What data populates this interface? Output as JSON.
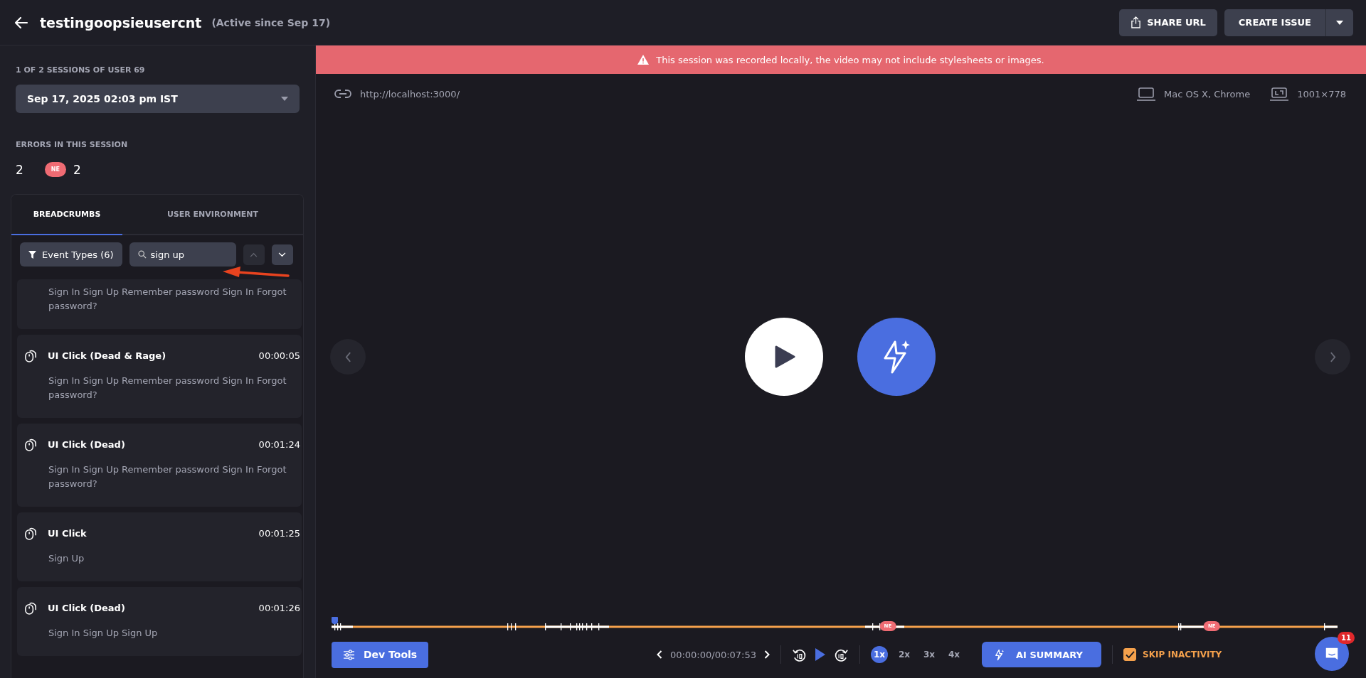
{
  "header": {
    "title": "testingoopsieusercnt",
    "subtitle": "(Active since Sep 17)",
    "share_button": "SHARE URL",
    "create_button": "CREATE ISSUE"
  },
  "sidebar": {
    "sessions_label": "1 OF 2 SESSIONS OF USER 69",
    "session_select": "Sep 17, 2025 02:03 pm IST",
    "errors_label": "ERRORS IN THIS SESSION",
    "error_total": "2",
    "error_badge": "NE",
    "error_badge_count": "2"
  },
  "tabs": [
    {
      "label": "BREADCRUMBS",
      "selected": true
    },
    {
      "label": "USER ENVIRONMENT",
      "selected": false
    }
  ],
  "filter": {
    "event_types": "Event Types (6)",
    "search_value": "sign up",
    "prev_disabled": true,
    "next_disabled": false
  },
  "events": [
    {
      "kind": "clipped",
      "detail": "Sign In Sign Up Remember password Sign In Forgot password?"
    },
    {
      "kind": "full",
      "title": "UI Click (Dead & Rage)",
      "time": "00:00:05",
      "detail": "Sign In Sign Up Remember password Sign In Forgot password?"
    },
    {
      "kind": "full",
      "title": "UI Click (Dead)",
      "time": "00:01:24",
      "detail": "Sign In Sign Up Remember password Sign In Forgot password?"
    },
    {
      "kind": "full",
      "title": "UI Click",
      "time": "00:01:25",
      "detail": "Sign Up"
    },
    {
      "kind": "full",
      "title": "UI Click (Dead)",
      "time": "00:01:26",
      "detail": "Sign In Sign Up Sign Up"
    }
  ],
  "banner": "This session was recorded locally, the video may not include stylesheets or images.",
  "player": {
    "url": "http://localhost:3000/",
    "platform": "Mac OS X, Chrome",
    "resolution": "1001×778"
  },
  "timeline": {
    "level": 0,
    "error_markers": [
      {
        "label": "NE"
      },
      {
        "label": "NE"
      }
    ]
  },
  "controls": {
    "dev_tools": "Dev Tools",
    "time": "00:00:00/00:07:53",
    "speeds": [
      {
        "label": "1x",
        "selected": true
      },
      {
        "label": "2x",
        "selected": false
      },
      {
        "label": "3x",
        "selected": false
      },
      {
        "label": "4x",
        "selected": false
      }
    ],
    "ai_summary": "AI SUMMARY",
    "skip_inactivity": {
      "label": "SKIP INACTIVITY",
      "checked": true
    }
  },
  "chat": {
    "badge": "11"
  }
}
